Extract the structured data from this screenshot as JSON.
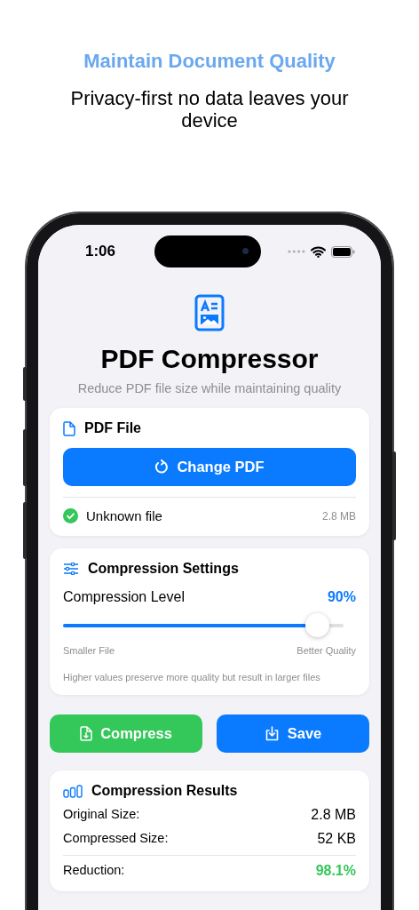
{
  "header": {
    "title": "Maintain Document Quality",
    "subtitle": "Privacy-first no data leaves your device"
  },
  "status_bar": {
    "time": "1:06"
  },
  "app": {
    "title": "PDF Compressor",
    "subtitle": "Reduce PDF file size while maintaining quality"
  },
  "file_card": {
    "title": "PDF File",
    "button": "Change PDF",
    "file_name": "Unknown file",
    "file_size": "2.8 MB",
    "loaded": true
  },
  "settings_card": {
    "title": "Compression Settings",
    "label": "Compression Level",
    "value": "90%",
    "level": 0.9,
    "min_label": "Smaller File",
    "max_label": "Better Quality",
    "hint": "Higher values preserve more quality but result in larger files"
  },
  "actions": [
    {
      "label": "Compress",
      "kind": "compress"
    },
    {
      "label": "Save",
      "kind": "save"
    }
  ],
  "results": {
    "title": "Compression Results",
    "rows": [
      {
        "label": "Original Size:",
        "value": "2.8 MB",
        "kind": "plain"
      },
      {
        "label": "Compressed Size:",
        "value": "52 KB",
        "kind": "plain"
      },
      {
        "label": "Reduction:",
        "value": "98.1%",
        "kind": "highlight"
      }
    ]
  }
}
